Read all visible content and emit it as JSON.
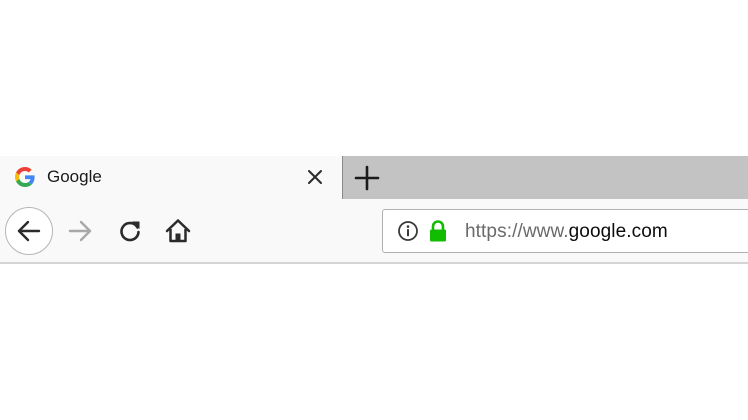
{
  "tab": {
    "favicon_icon": "google-g-icon",
    "title": "Google",
    "close_icon": "close-icon"
  },
  "tab_strip": {
    "new_tab_icon": "plus-icon"
  },
  "nav": {
    "back_icon": "back-arrow-icon",
    "forward_icon": "forward-arrow-icon",
    "reload_icon": "reload-icon",
    "home_icon": "home-icon"
  },
  "url_bar": {
    "info_icon": "info-icon",
    "lock_icon": "lock-icon",
    "scheme": "https://",
    "subdomain": "www.",
    "host": "google.com"
  },
  "colors": {
    "tab_background": "#f9f9fa",
    "tab_strip_background": "#c3c3c3",
    "lock_green": "#12bc00",
    "url_dim": "#6a6a6a",
    "google_blue": "#4285f4",
    "google_red": "#ea4335",
    "google_yellow": "#fbbc05",
    "google_green": "#34a853"
  }
}
